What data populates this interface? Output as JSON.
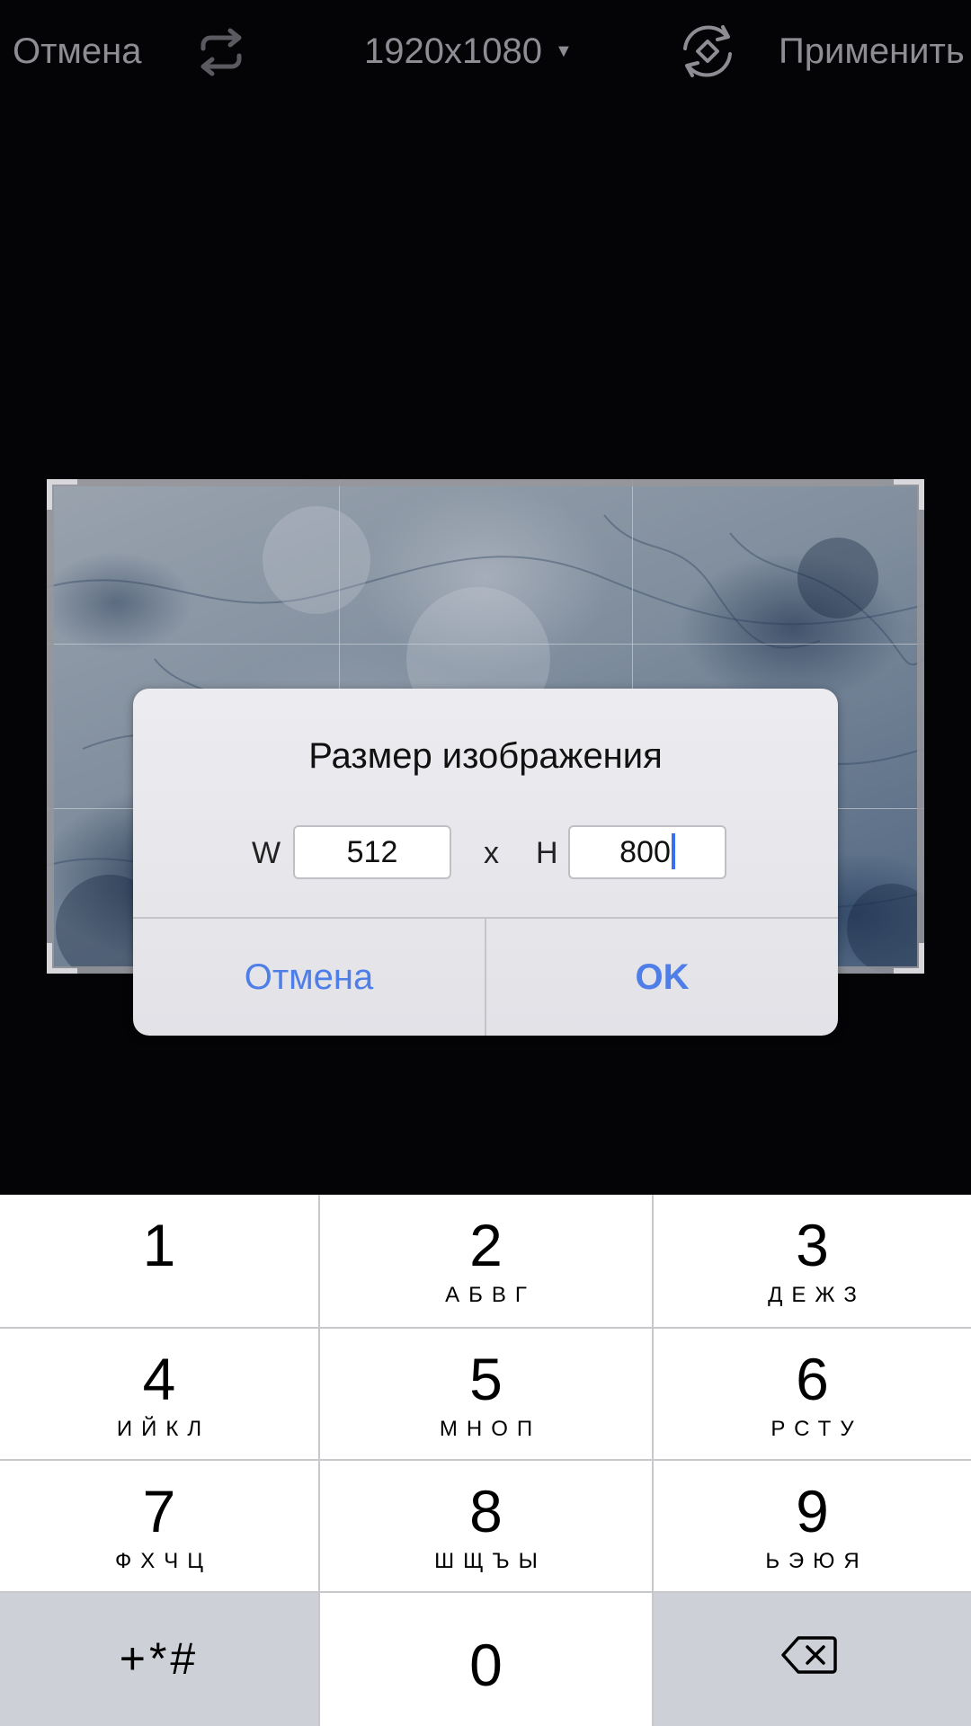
{
  "toolbar": {
    "cancel_label": "Отмена",
    "flip_icon": "flip-icon",
    "size_label": "1920x1080",
    "size_caret": "▼",
    "rotate_icon": "rotate-icon",
    "apply_label": "Применить"
  },
  "dialog": {
    "title": "Размер изображения",
    "width_prefix": "W",
    "width_value": "512",
    "separator": "x",
    "height_prefix": "H",
    "height_value": "800",
    "cancel_label": "Отмена",
    "ok_label": "OK"
  },
  "keypad": {
    "keys": [
      {
        "digit": "1",
        "letters": ""
      },
      {
        "digit": "2",
        "letters": "АБВГ"
      },
      {
        "digit": "3",
        "letters": "ДЕЖЗ"
      },
      {
        "digit": "4",
        "letters": "ИЙКЛ"
      },
      {
        "digit": "5",
        "letters": "МНОП"
      },
      {
        "digit": "6",
        "letters": "РСТУ"
      },
      {
        "digit": "7",
        "letters": "ФХЧЦ"
      },
      {
        "digit": "8",
        "letters": "ШЩЪЫ"
      },
      {
        "digit": "9",
        "letters": "ЬЭЮЯ"
      }
    ],
    "symbols_label": "+*#",
    "zero": "0",
    "backspace_icon": "backspace-icon"
  },
  "colors": {
    "background": "#040306",
    "toolbar_text": "#8d8d93",
    "dialog_accent": "#4f7ee8",
    "cursor": "#3a6ff2"
  }
}
